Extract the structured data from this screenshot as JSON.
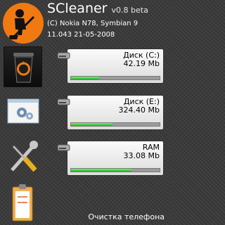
{
  "header": {
    "title": "SCleaner",
    "version": "v0.8 beta",
    "device_line": "(C) Nokia N78, Symbian 9",
    "build_line": "11.043 21-05-2008"
  },
  "items": [
    {
      "name": "Диск (C:)",
      "value": "42.19 Mb",
      "usage": 0.32
    },
    {
      "name": "Диск (E:)",
      "value": "324.40 Mb",
      "usage": 0.47
    },
    {
      "name": "RAM",
      "value": "33.08 Mb",
      "usage": 0.68
    }
  ],
  "softkey": {
    "right": "Очистка телефона"
  },
  "colors": {
    "accent": "#f07a10",
    "bar_fill": "#2fbf2f",
    "background": "#3a3a3a"
  },
  "icons": [
    "cleaner-logo-icon",
    "recycle-bin-icon",
    "settings-window-icon",
    "tools-icon",
    "clipboard-icon",
    "hard-drive-icon"
  ]
}
